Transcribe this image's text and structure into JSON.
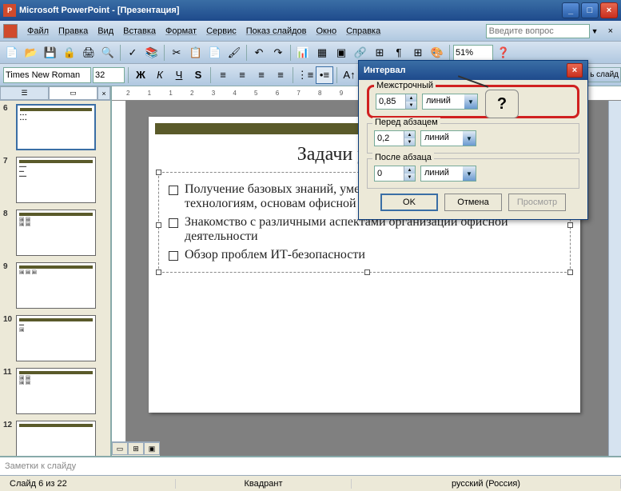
{
  "titlebar": {
    "app": "Microsoft PowerPoint",
    "doc": "[Презентация]"
  },
  "menu": {
    "file": "Файл",
    "edit": "Правка",
    "view": "Вид",
    "insert": "Вставка",
    "format": "Формат",
    "tools": "Сервис",
    "show": "Показ слайдов",
    "window": "Окно",
    "help": "Справка"
  },
  "helpbox": {
    "placeholder": "Введите вопрос"
  },
  "font": {
    "name": "Times New Roman",
    "size": "32"
  },
  "zoom": "51%",
  "task_hint": "ь слайд",
  "ruler": "2 1 1 2 3 4 5 6 7 8 9 10 11 12",
  "thumbnails": [
    {
      "n": "6",
      "active": true
    },
    {
      "n": "7"
    },
    {
      "n": "8"
    },
    {
      "n": "9"
    },
    {
      "n": "10"
    },
    {
      "n": "11"
    },
    {
      "n": "12"
    }
  ],
  "slide": {
    "title": "Задачи учебного",
    "bullets": [
      "Получение базовых знаний, умений и навыков по информационным технологиям, основам офисной деятельности и делового общения",
      "Знакомство с различными аспектами организации офисной деятельности",
      "Обзор проблем ИТ-безопасности"
    ]
  },
  "notes": {
    "placeholder": "Заметки к слайду"
  },
  "status": {
    "slide": "Слайд 6 из 22",
    "layout": "Квадрант",
    "lang": "русский (Россия)"
  },
  "dialog": {
    "title": "Интервал",
    "line_spacing": {
      "label": "Межстрочный",
      "value": "0,85",
      "unit": "линий"
    },
    "before": {
      "label": "Перед абзацем",
      "value": "0,2",
      "unit": "линий"
    },
    "after": {
      "label": "После абзаца",
      "value": "0",
      "unit": "линий"
    },
    "callout": "?",
    "ok": "OK",
    "cancel": "Отмена",
    "preview": "Просмотр"
  }
}
